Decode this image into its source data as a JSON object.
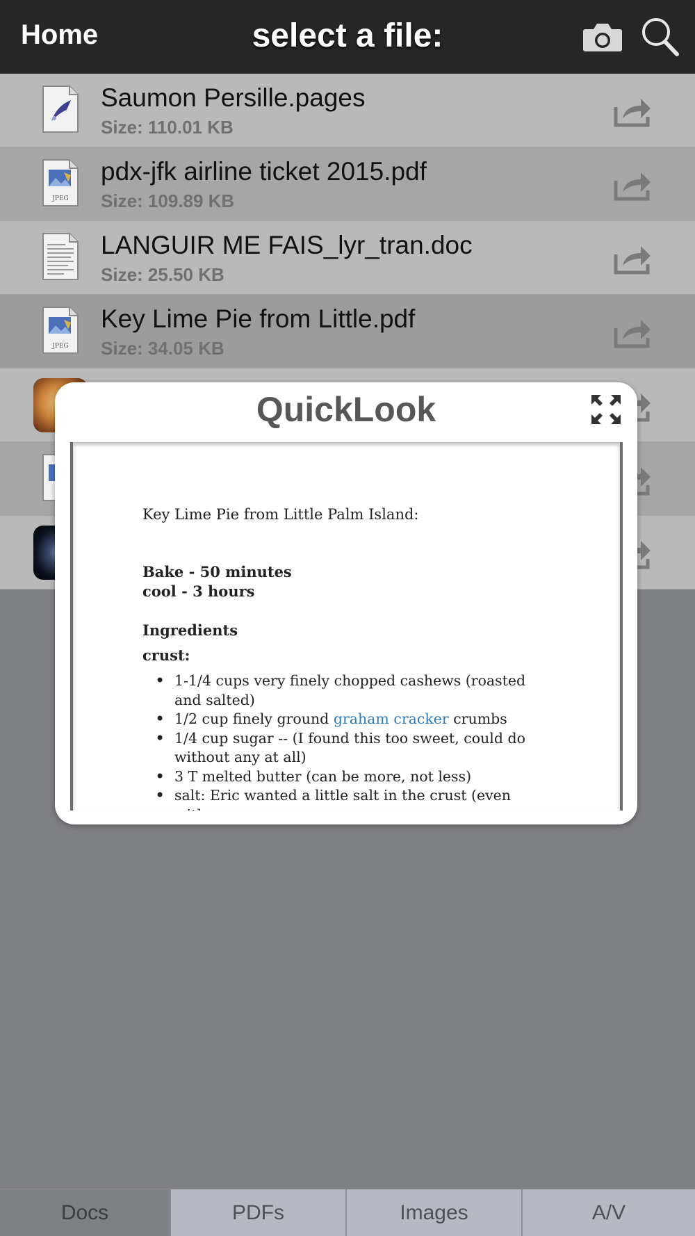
{
  "header": {
    "home_label": "Home",
    "title": "select a file:",
    "camera_icon": "camera-icon",
    "search_icon": "search-icon"
  },
  "files": [
    {
      "name": "Saumon Persille.pages",
      "size": "Size: 110.01 KB",
      "icon": "pages-document-icon"
    },
    {
      "name": "pdx-jfk airline ticket 2015.pdf",
      "size": "Size: 109.89 KB",
      "icon": "jpeg-preview-icon"
    },
    {
      "name": "LANGUIR ME FAIS_lyr_tran.doc",
      "size": "Size: 25.50 KB",
      "icon": "text-document-icon"
    },
    {
      "name": "Key Lime Pie from Little.pdf",
      "size": "Size: 34.05 KB",
      "icon": "jpeg-preview-icon",
      "selected": true
    }
  ],
  "quicklook": {
    "title": "QuickLook",
    "expand_icon": "expand-icon",
    "document": {
      "title": "Key Lime Pie from Little Palm Island:",
      "bake": "Bake - 50 minutes",
      "cool": "cool - 3 hours",
      "ingredients_heading": "Ingredients",
      "crust_heading": "crust:",
      "crust_items": {
        "item1": "1-1/4 cups very finely chopped cashews (roasted and salted)",
        "item2_before": "1/2 cup finely ground ",
        "item2_link": "graham cracker",
        "item2_after": " crumbs",
        "item3": "1/4 cup sugar -- (I found this too sweet, could do without any at all)",
        "item4": "3 T melted butter (can be more, not less)",
        "item5": "salt: Eric wanted a little salt in the crust (even with"
      }
    }
  },
  "tabs": {
    "docs": "Docs",
    "pdfs": "PDFs",
    "images": "Images",
    "av": "A/V"
  },
  "colors": {
    "header_bg": "#262626",
    "link": "#2f7bb6",
    "background": "#7f8084"
  }
}
